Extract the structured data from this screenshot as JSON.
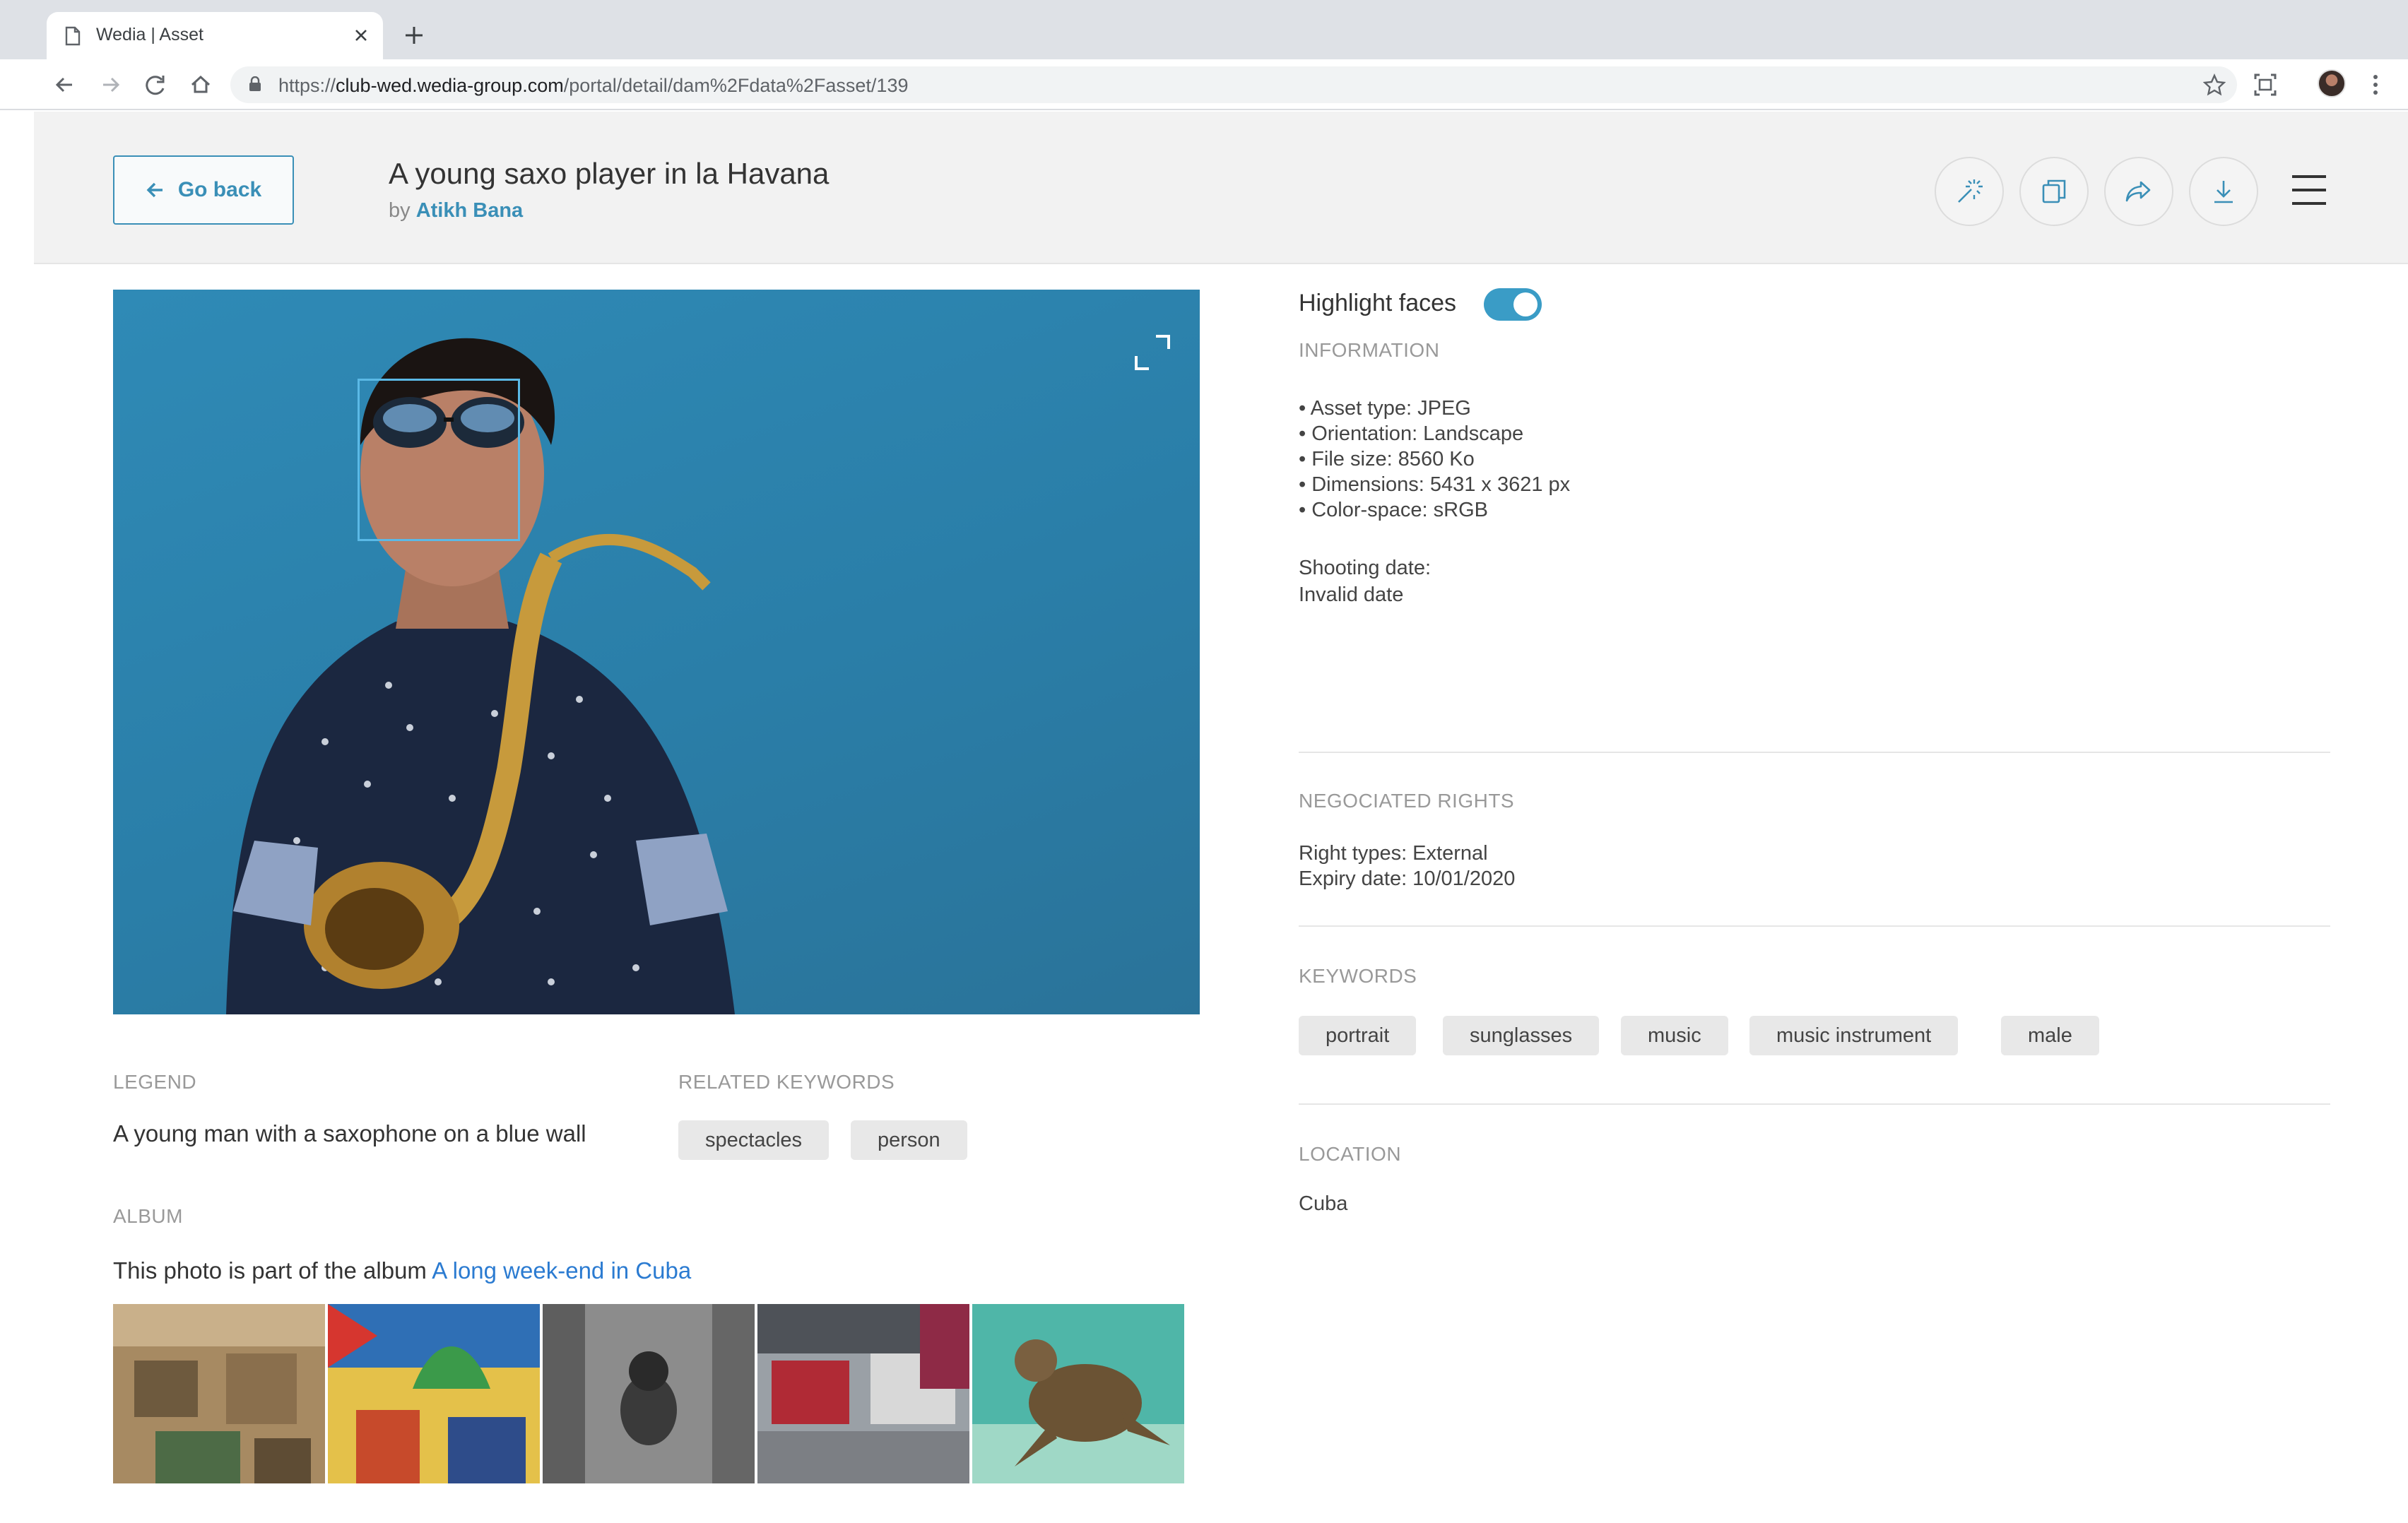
{
  "browser": {
    "tab_title": "Wedia | Asset",
    "url_prefix": "https://",
    "url_host": "club-wed.wedia-group.com",
    "url_path": "/portal/detail/dam%2Fdata%2Fasset/139"
  },
  "header": {
    "go_back_label": "Go back",
    "asset_title": "A young saxo player in la Havana",
    "by_prefix": "by",
    "author": "Atikh Bana"
  },
  "info": {
    "highlight_faces_label": "Highlight faces",
    "highlight_faces_on": true,
    "information_label": "INFORMATION",
    "information_items": [
      "• Asset type: JPEG",
      "• Orientation: Landscape",
      "• File size: 8560 Ko",
      "• Dimensions: 5431 x 3621 px",
      "• Color-space: sRGB"
    ],
    "shooting_date_label": "Shooting date:",
    "shooting_date_value": "Invalid date",
    "rights_label": "NEGOCIATED RIGHTS",
    "right_types": "Right types: External",
    "expiry_date": "Expiry date: 10/01/2020",
    "keywords_label": "KEYWORDS",
    "keywords": [
      "portrait",
      "sunglasses",
      "music",
      "music instrument",
      "male"
    ],
    "location_label": "LOCATION",
    "location_value": "Cuba"
  },
  "lower": {
    "legend_label": "LEGEND",
    "legend_text": "A young man with a saxophone on a blue wall",
    "related_label": "RELATED KEYWORDS",
    "related_keywords": [
      "spectacles",
      "person"
    ],
    "album_label": "ALBUM",
    "album_prefix": "This photo is part of the album ",
    "album_link": "A long week-end in Cuba"
  },
  "colors": {
    "accent": "#3a8fb7",
    "link": "#2b7bd1",
    "header_bg": "#f2f2f2",
    "chip_bg": "#e8e8e8"
  }
}
